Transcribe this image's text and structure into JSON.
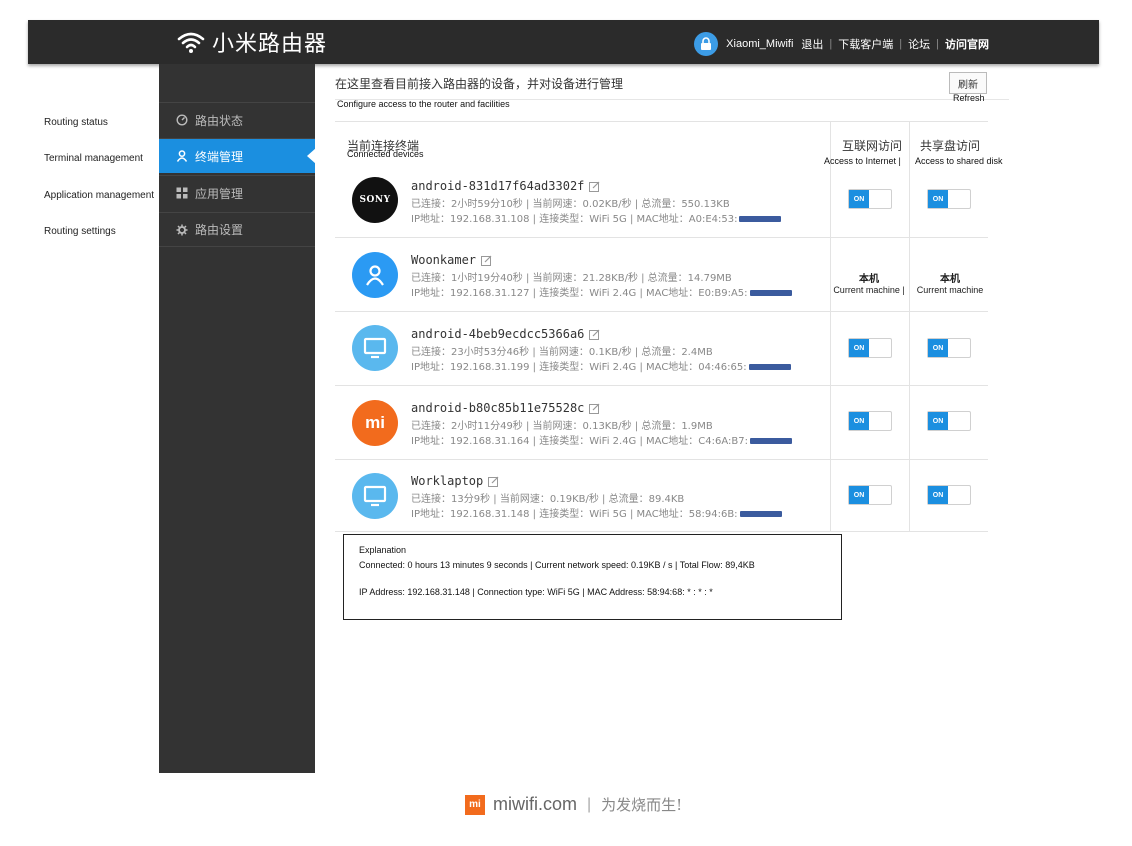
{
  "header": {
    "brand_name": "小米路由器",
    "account": "Xiaomi_Miwifi",
    "links": [
      "退出",
      "下载客户端",
      "论坛",
      "访问官网"
    ]
  },
  "annotations": {
    "side": [
      "Routing status",
      "Terminal management",
      "Application management",
      "Routing settings"
    ],
    "configure": "Configure access to the router and facilities",
    "refresh": "Refresh",
    "connected_devices": "Connected devices",
    "access_internet": "Access to Internet |",
    "access_disk": "Access to shared disk",
    "current_machine_1": "Current machine |",
    "current_machine_2": "Current machine"
  },
  "sidebar": {
    "items": [
      {
        "label": "路由状态",
        "icon": "status-icon"
      },
      {
        "label": "终端管理",
        "icon": "user-icon",
        "active": true
      },
      {
        "label": "应用管理",
        "icon": "apps-icon"
      },
      {
        "label": "路由设置",
        "icon": "gear-icon"
      }
    ]
  },
  "main": {
    "title": "在这里查看目前接入路由器的设备，并对设备进行管理",
    "refresh_label": "刷新",
    "col_devices": "当前连接终端",
    "col_internet": "互联网访问",
    "col_disk": "共享盘访问",
    "local_label": "本机",
    "toggle_on": "ON"
  },
  "devices": [
    {
      "name": "android-831d17f64ad3302f",
      "line1": "已连接：2小时59分10秒 | 当前网速：0.02KB/秒 | 总流量：550.13KB",
      "line2": "IP地址：192.168.31.108 | 连接类型：WiFi 5G | MAC地址：A0:E4:53:",
      "avatar": "sony-logo",
      "avatar_text": "SONY",
      "color": "#111111"
    },
    {
      "name": "Woonkamer",
      "line1": "已连接：1小时19分40秒 | 当前网速：21.28KB/秒 | 总流量：14.79MB",
      "line2": "IP地址：192.168.31.127 | 连接类型：WiFi 2.4G | MAC地址：E0:B9:A5:",
      "avatar": "person-icon",
      "color": "#2b9af3"
    },
    {
      "name": "android-4beb9ecdcc5366a6",
      "line1": "已连接：23小时53分46秒 | 当前网速：0.1KB/秒 | 总流量：2.4MB",
      "line2": "IP地址：192.168.31.199 | 连接类型：WiFi 2.4G | MAC地址：04:46:65:",
      "avatar": "monitor-icon",
      "color": "#5ab8ee"
    },
    {
      "name": "android-b80c85b11e75528c",
      "line1": "已连接：2小时11分49秒 | 当前网速：0.13KB/秒 | 总流量：1.9MB",
      "line2": "IP地址：192.168.31.164 | 连接类型：WiFi 2.4G | MAC地址：C4:6A:B7:",
      "avatar": "mi-logo",
      "avatar_text": "mi",
      "color": "#f26b1d"
    },
    {
      "name": "Worklaptop",
      "line1": "已连接：13分9秒 | 当前网速：0.19KB/秒 | 总流量：89.4KB",
      "line2": "IP地址：192.168.31.148 | 连接类型：WiFi 5G | MAC地址：58:94:6B:",
      "avatar": "monitor-icon",
      "color": "#5ab8ee"
    }
  ],
  "explanation": {
    "title": "Explanation",
    "line1": "Connected: 0 hours 13 minutes 9 seconds | Current network speed: 0.19KB / s | Total Flow: 89,4KB",
    "line2": "IP Address: 192.168.31.148 | Connection type: WiFi 5G | MAC Address: 58:94:68: * : * : *"
  },
  "footer": {
    "logo_text": "mi",
    "site": "miwifi.com",
    "slogan": "为发烧而生!"
  }
}
